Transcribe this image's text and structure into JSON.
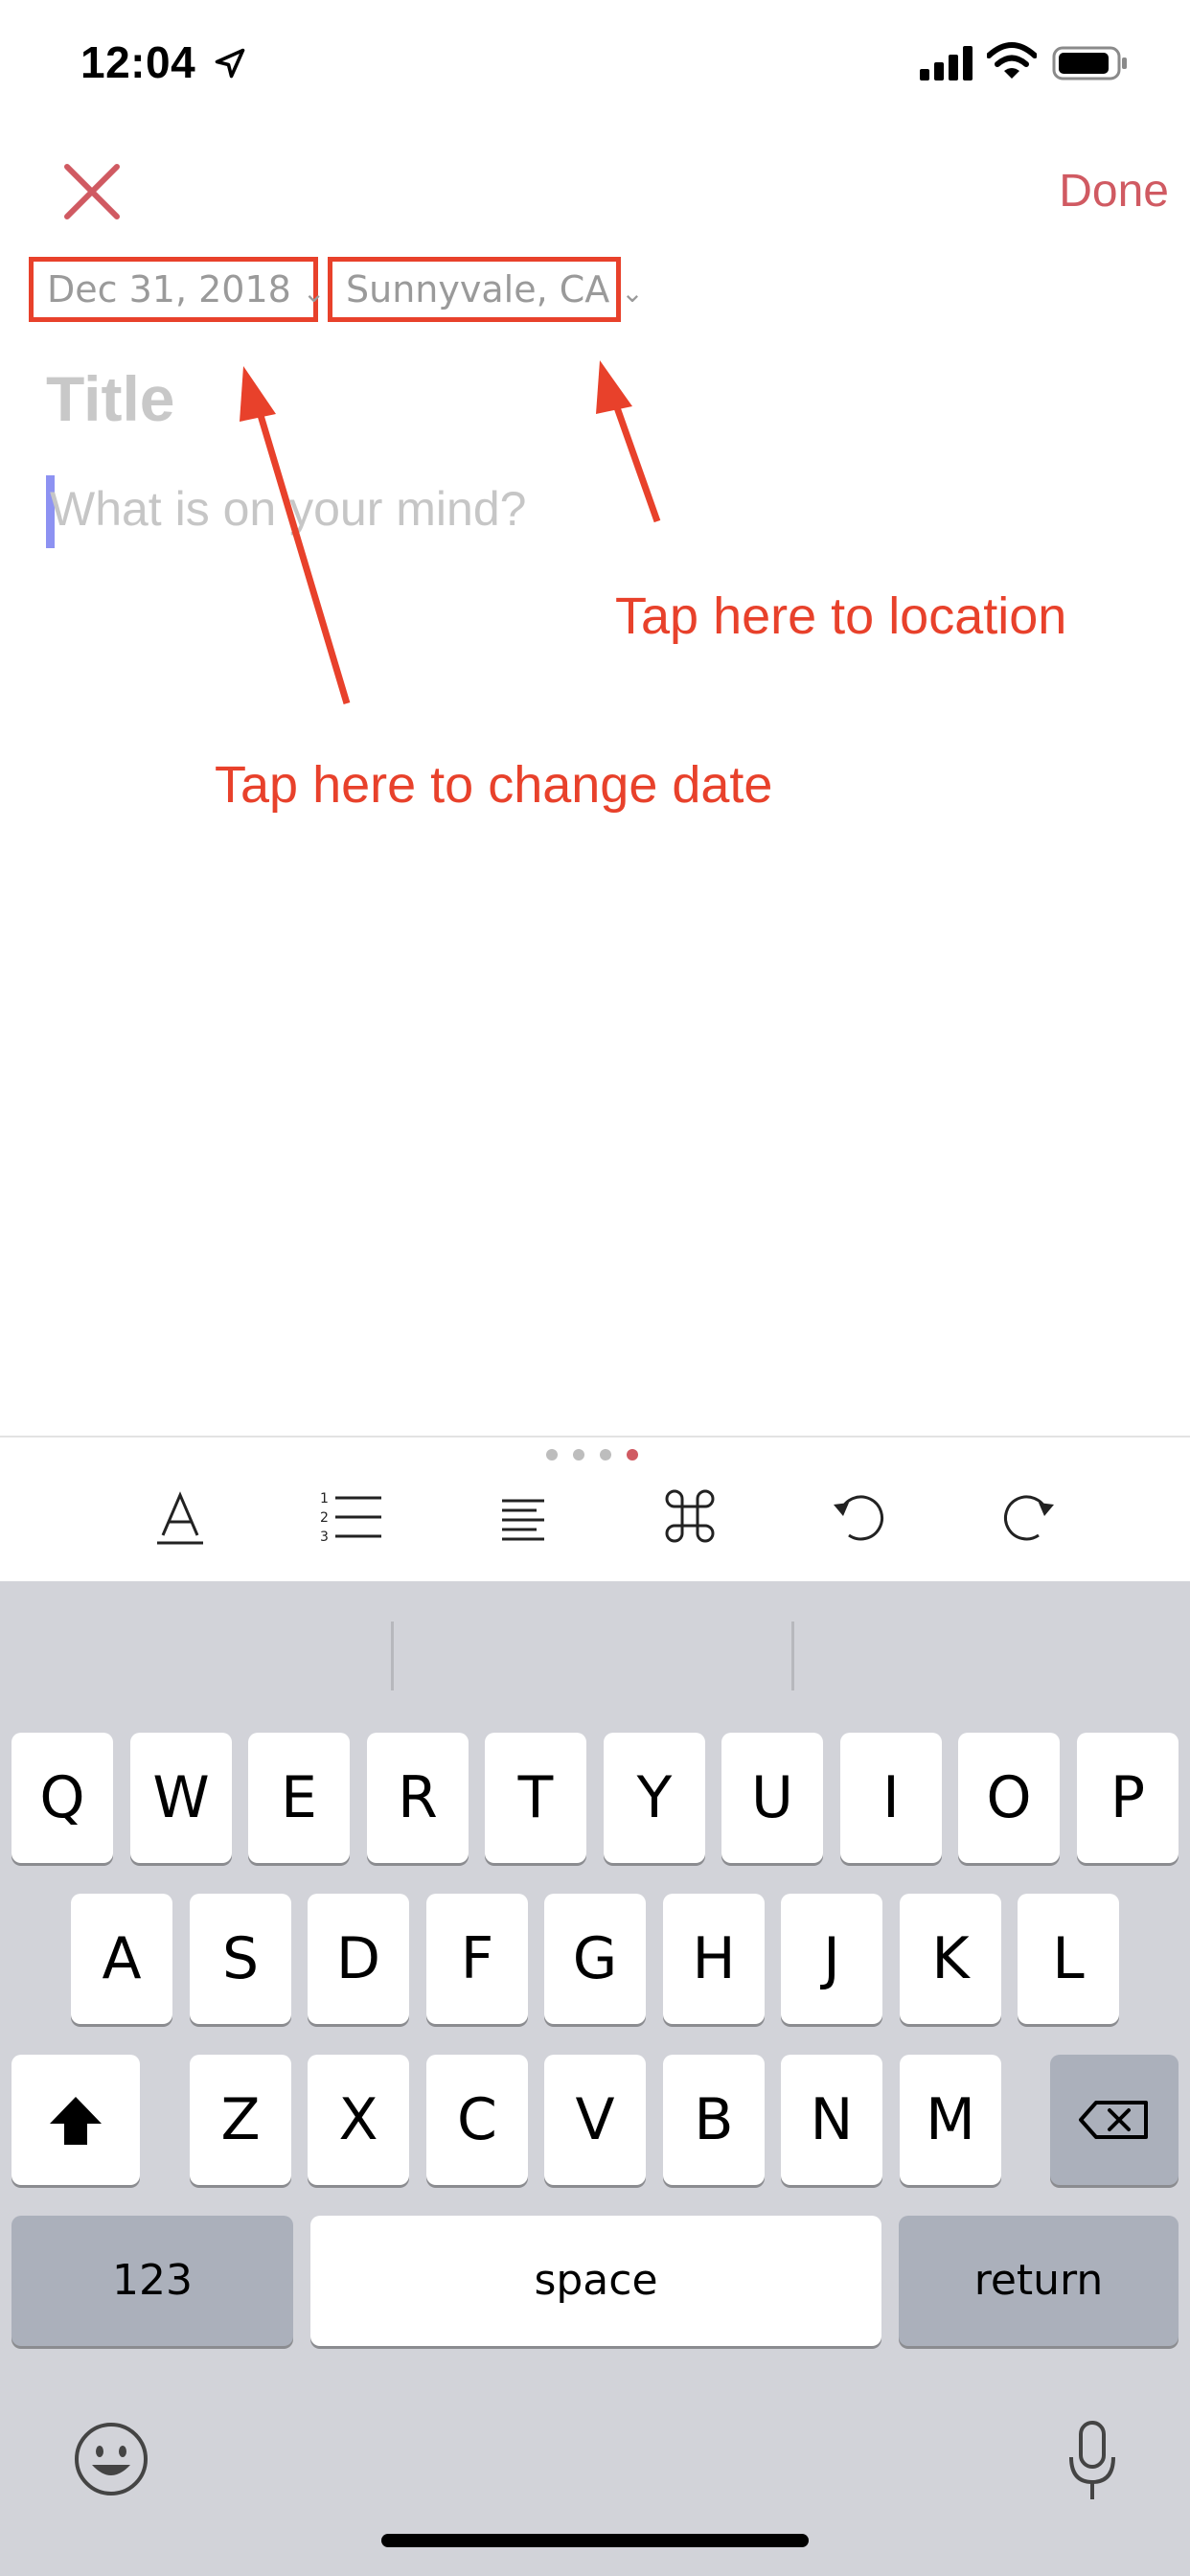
{
  "status_bar": {
    "time": "12:04"
  },
  "nav": {
    "done_label": "Done"
  },
  "entry": {
    "date": "Dec 31, 2018",
    "location": "Sunnyvale, CA",
    "title_placeholder": "Title",
    "body_placeholder": "What is on your mind?"
  },
  "annotations": {
    "location_hint": "Tap here to location",
    "date_hint": "Tap here to change date"
  },
  "toolbar": {
    "icons": [
      "text-format-icon",
      "numbered-list-icon",
      "align-icon",
      "command-icon",
      "undo-icon",
      "redo-icon"
    ],
    "page_dots": 4,
    "active_dot": 4
  },
  "keyboard": {
    "row1": [
      "Q",
      "W",
      "E",
      "R",
      "T",
      "Y",
      "U",
      "I",
      "O",
      "P"
    ],
    "row2": [
      "A",
      "S",
      "D",
      "F",
      "G",
      "H",
      "J",
      "K",
      "L"
    ],
    "row3": [
      "Z",
      "X",
      "C",
      "V",
      "B",
      "N",
      "M"
    ],
    "numbers_label": "123",
    "space_label": "space",
    "return_label": "return"
  },
  "colors": {
    "accent": "#d05a62",
    "annotation": "#e8412b",
    "caret": "#8d92f2",
    "keyboard_bg": "#d2d3d9"
  }
}
